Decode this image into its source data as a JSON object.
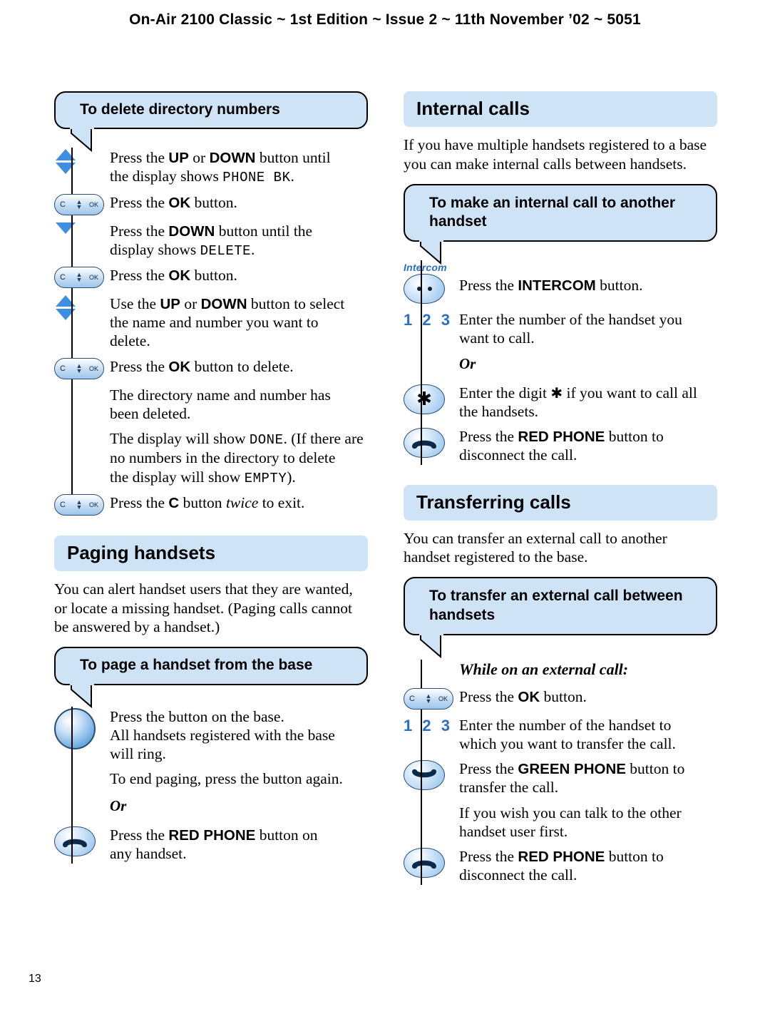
{
  "header": {
    "text": "On-Air 2100 Classic ~ 1st Edition ~ Issue 2 ~ 11th November ’02 ~ 5051"
  },
  "page_number": "13",
  "left_column": {
    "section1": {
      "heading": "To delete directory numbers",
      "steps": [
        {
          "icon": "up-down-arrow-icon",
          "text_parts": [
            "Press the ",
            "UP",
            " or ",
            "DOWN",
            " button until the display shows ",
            "PHONE BK",
            "."
          ]
        },
        {
          "icon": "ok-button-icon",
          "text_parts": [
            "Press the ",
            "OK",
            " button."
          ]
        },
        {
          "icon": "down-arrow-icon",
          "text_parts": [
            "Press the ",
            "DOWN",
            " button until the display shows ",
            "DELETE",
            "."
          ]
        },
        {
          "icon": "ok-button-icon",
          "text_parts": [
            "Press the ",
            "OK",
            " button."
          ]
        },
        {
          "icon": "up-down-arrow-icon",
          "text_parts": [
            "Use the ",
            "UP",
            " or ",
            "DOWN",
            " button to select the name and number you want to delete."
          ]
        },
        {
          "icon": "ok-button-icon",
          "text_parts": [
            "Press the ",
            "OK",
            " button to delete."
          ]
        },
        {
          "icon": "none",
          "text_parts": [
            "The directory name and number has been deleted."
          ]
        },
        {
          "icon": "none",
          "text_parts": [
            "The display will show ",
            "DONE",
            ". (If there are no numbers in the directory to delete the display will show ",
            "EMPTY",
            ")."
          ]
        },
        {
          "icon": "ok-button-icon",
          "text_parts": [
            "Press the ",
            "C",
            " button ",
            "twice",
            " to exit."
          ]
        }
      ]
    },
    "section2": {
      "heading": "Paging handsets",
      "intro": "You can alert handset users that they are wanted, or locate a missing handset. (Paging calls cannot be answered by a handset.)",
      "subheading": "To page a handset from the base",
      "steps": [
        {
          "icon": "base-button-icon",
          "text_parts": [
            "Press the button on the base. All handsets registered with the base will ring."
          ]
        },
        {
          "icon": "none",
          "text_parts": [
            "To end paging, press the button again."
          ]
        },
        {
          "icon": "or",
          "text_parts": [
            "Or"
          ]
        },
        {
          "icon": "red-phone-icon",
          "text_parts": [
            "Press the ",
            "RED PHONE",
            " button on any handset."
          ]
        }
      ]
    }
  },
  "right_column": {
    "section1": {
      "heading": "Internal calls",
      "intro": "If you have multiple handsets registered to a base you can make internal calls between handsets.",
      "subheading": "To make an internal call to another handset",
      "steps": [
        {
          "icon": "intercom-button-icon",
          "text_parts": [
            "Press the ",
            "INTERCOM",
            " button."
          ]
        },
        {
          "icon": "keypad-123-icon",
          "text_parts": [
            "Enter the number of the handset you want to call."
          ]
        },
        {
          "icon": "or",
          "text_parts": [
            "Or"
          ]
        },
        {
          "icon": "star-key-icon",
          "text_parts": [
            "Enter the digit ",
            "✱",
            " if you want to call all the handsets."
          ]
        },
        {
          "icon": "red-phone-icon",
          "text_parts": [
            "Press the ",
            "RED PHONE",
            " button to disconnect the call."
          ]
        }
      ]
    },
    "section2": {
      "heading": "Transferring calls",
      "intro": "You can transfer an external call to another handset registered to the base.",
      "subheading": "To transfer an external call between handsets",
      "note": "While on an external call:",
      "steps": [
        {
          "icon": "ok-button-icon",
          "text_parts": [
            "Press the ",
            "OK",
            " button."
          ]
        },
        {
          "icon": "keypad-123-icon",
          "text_parts": [
            "Enter the number of the handset to which you want to transfer the call."
          ]
        },
        {
          "icon": "green-phone-icon",
          "text_parts": [
            "Press the ",
            "GREEN PHONE",
            " button to transfer the call."
          ]
        },
        {
          "icon": "none",
          "text_parts": [
            "If you wish you can talk to the other handset user first."
          ]
        },
        {
          "icon": "red-phone-icon",
          "text_parts": [
            "Press the ",
            "RED PHONE",
            " button to disconnect the call."
          ]
        }
      ]
    }
  },
  "icon_labels": {
    "intercom": "Intercom",
    "keypad": "1 2 3",
    "ok_c": "C",
    "ok_ok": "OK",
    "star": "✱"
  },
  "colors": {
    "heading_bg": "#cfe3f7",
    "accent_blue": "#2a6fc4",
    "arrow_blue": "#3f8fe0"
  }
}
